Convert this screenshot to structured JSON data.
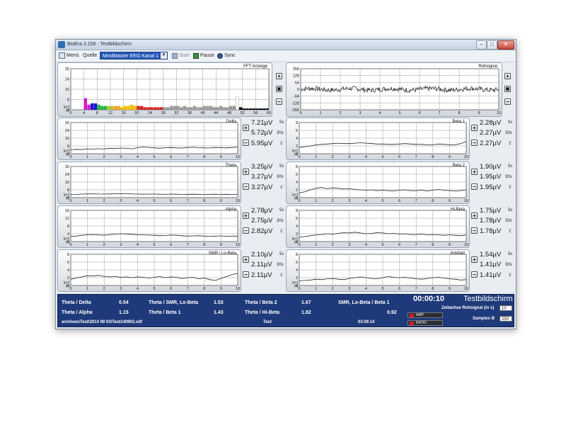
{
  "window": {
    "title": "BioEra 3.156 - Testbildschirm",
    "min": "–",
    "max": "□",
    "close": "✕"
  },
  "toolbar": {
    "menu": "Menü",
    "source_label": "Quelle",
    "source_value": "MindMaster EEG Kanal 1",
    "start": "Start",
    "pause": "Pause",
    "sync": "Sync"
  },
  "fft": {
    "title": "FFT Anzeige",
    "ylim": [
      0,
      32
    ],
    "yticks": [
      "32",
      "24",
      "16",
      "8",
      "0"
    ],
    "xticks": [
      "0",
      "4",
      "8",
      "12",
      "16",
      "20",
      "24",
      "28",
      "32",
      "36",
      "40",
      "44",
      "48",
      "52",
      "56",
      "60"
    ],
    "unit": "[µV]",
    "unit2": "[0]",
    "bars": [
      {
        "x": 4,
        "v": 9,
        "c": "#d319c8"
      },
      {
        "x": 5,
        "v": 4,
        "c": "#d319c8"
      },
      {
        "x": 6,
        "v": 5,
        "c": "#1919d3"
      },
      {
        "x": 7,
        "v": 5,
        "c": "#1919d3"
      },
      {
        "x": 8,
        "v": 4,
        "c": "#23b53c"
      },
      {
        "x": 9,
        "v": 3,
        "c": "#23b53c"
      },
      {
        "x": 10,
        "v": 3,
        "c": "#23b53c"
      },
      {
        "x": 11,
        "v": 3,
        "c": "#b5c23c"
      },
      {
        "x": 12,
        "v": 3,
        "c": "#b5c23c"
      },
      {
        "x": 13,
        "v": 3,
        "c": "#f0a020"
      },
      {
        "x": 14,
        "v": 3,
        "c": "#f0a020"
      },
      {
        "x": 15,
        "v": 2,
        "c": "#f0c000"
      },
      {
        "x": 16,
        "v": 3,
        "c": "#f0c000"
      },
      {
        "x": 17,
        "v": 3,
        "c": "#f0c000"
      },
      {
        "x": 18,
        "v": 4,
        "c": "#f0c000"
      },
      {
        "x": 19,
        "v": 3,
        "c": "#f0c000"
      },
      {
        "x": 20,
        "v": 3,
        "c": "#d52525"
      },
      {
        "x": 21,
        "v": 3,
        "c": "#d52525"
      },
      {
        "x": 22,
        "v": 2,
        "c": "#d52525"
      },
      {
        "x": 23,
        "v": 2,
        "c": "#d52525"
      },
      {
        "x": 24,
        "v": 2,
        "c": "#d52525"
      },
      {
        "x": 25,
        "v": 2,
        "c": "#d52525"
      },
      {
        "x": 26,
        "v": 2,
        "c": "#d52525"
      },
      {
        "x": 27,
        "v": 2,
        "c": "#d52525"
      },
      {
        "x": 28,
        "v": 2,
        "c": "#9a9a9a"
      },
      {
        "x": 29,
        "v": 2,
        "c": "#9a9a9a"
      },
      {
        "x": 30,
        "v": 3,
        "c": "#9a9a9a"
      },
      {
        "x": 31,
        "v": 3,
        "c": "#9a9a9a"
      },
      {
        "x": 32,
        "v": 3,
        "c": "#9a9a9a"
      },
      {
        "x": 33,
        "v": 2,
        "c": "#9a9a9a"
      },
      {
        "x": 34,
        "v": 3,
        "c": "#9a9a9a"
      },
      {
        "x": 35,
        "v": 2,
        "c": "#9a9a9a"
      },
      {
        "x": 36,
        "v": 2,
        "c": "#9a9a9a"
      },
      {
        "x": 37,
        "v": 3,
        "c": "#9a9a9a"
      },
      {
        "x": 38,
        "v": 2,
        "c": "#9a9a9a"
      },
      {
        "x": 39,
        "v": 2,
        "c": "#9a9a9a"
      },
      {
        "x": 40,
        "v": 3,
        "c": "#9a9a9a"
      },
      {
        "x": 41,
        "v": 3,
        "c": "#9a9a9a"
      },
      {
        "x": 42,
        "v": 3,
        "c": "#9a9a9a"
      },
      {
        "x": 43,
        "v": 2,
        "c": "#9a9a9a"
      },
      {
        "x": 44,
        "v": 2,
        "c": "#9a9a9a"
      },
      {
        "x": 45,
        "v": 3,
        "c": "#9a9a9a"
      },
      {
        "x": 46,
        "v": 2,
        "c": "#9a9a9a"
      },
      {
        "x": 47,
        "v": 2,
        "c": "#9a9a9a"
      },
      {
        "x": 48,
        "v": 3,
        "c": "#9a9a9a"
      },
      {
        "x": 49,
        "v": 3,
        "c": "#9a9a9a"
      },
      {
        "x": 50,
        "v": 10,
        "c": "#ffffff"
      },
      {
        "x": 51,
        "v": 2,
        "c": "#000000"
      },
      {
        "x": 52,
        "v": 1,
        "c": "#000000"
      },
      {
        "x": 53,
        "v": 1,
        "c": "#000000"
      },
      {
        "x": 54,
        "v": 1,
        "c": "#000000"
      },
      {
        "x": 55,
        "v": 1,
        "c": "#000000"
      },
      {
        "x": 56,
        "v": 1,
        "c": "#000000"
      },
      {
        "x": 57,
        "v": 1,
        "c": "#000000"
      },
      {
        "x": 58,
        "v": 1,
        "c": "#000000"
      },
      {
        "x": 59,
        "v": 1,
        "c": "#000000"
      }
    ]
  },
  "raw": {
    "title": "Rohsignal",
    "yticks": [
      "256",
      "128",
      "64",
      "0",
      "-64",
      "-128",
      "-256"
    ],
    "xticks": [
      "0",
      "1",
      "2",
      "3",
      "4",
      "5",
      "6",
      "7",
      "8",
      "9",
      "10"
    ]
  },
  "bands": [
    {
      "id": "delta",
      "title": "Delta",
      "yticks": [
        "32",
        "24",
        "16",
        "8",
        "0"
      ],
      "ymax": 32,
      "values": [
        "7.21µV",
        "5.72µV",
        "5.95µV"
      ],
      "points": [
        4,
        4.5,
        4.2,
        5,
        4.7,
        5.2,
        4.8,
        5.6,
        5.3,
        5.8,
        5.5,
        5.0,
        6.2,
        6.9,
        6.5,
        6.0,
        5.7,
        6.1,
        6.4,
        6.0,
        5.8,
        6.3,
        6.6,
        6.2,
        6.0,
        5.9,
        6.4,
        6.2,
        6.0,
        6.4,
        6.8
      ]
    },
    {
      "id": "beta1",
      "title": "Beta 1",
      "yticks": [
        "8",
        "6",
        "4",
        "2",
        "0"
      ],
      "ymax": 8,
      "values": [
        "2.28µV",
        "2.27µV",
        "2.27µV"
      ],
      "points": [
        1.6,
        1.8,
        2.0,
        2.3,
        2.4,
        2.5,
        2.6,
        2.7,
        2.6,
        2.6,
        2.7,
        2.8,
        2.7,
        2.6,
        2.5,
        2.5,
        2.4,
        2.4,
        2.5,
        2.6,
        2.5,
        2.4,
        2.4,
        2.3,
        2.3,
        2.5,
        2.4,
        2.3,
        2.3,
        2.6,
        3.1
      ]
    },
    {
      "id": "theta",
      "title": "Theta",
      "yticks": [
        "32",
        "24",
        "16",
        "8",
        "0"
      ],
      "ymax": 32,
      "values": [
        "3.25µV",
        "3.27µV",
        "3.27µV"
      ],
      "points": [
        3.2,
        3.3,
        3.6,
        3.8,
        3.9,
        3.7,
        3.6,
        3.8,
        3.9,
        4.1,
        4.0,
        3.8,
        3.7,
        3.5,
        3.6,
        3.7,
        3.5,
        3.4,
        3.6,
        3.5,
        3.3,
        3.4,
        3.5,
        3.4,
        3.3,
        3.4,
        3.5,
        3.3,
        3.4,
        3.3,
        3.3
      ]
    },
    {
      "id": "beta2",
      "title": "Beta 2",
      "yticks": [
        "8",
        "6",
        "4",
        "2",
        "0"
      ],
      "ymax": 8,
      "values": [
        "1.90µV",
        "1.95µV",
        "1.95µV"
      ],
      "points": [
        1.2,
        1.5,
        2.0,
        2.4,
        2.6,
        2.3,
        2.5,
        2.4,
        2.2,
        2.3,
        2.1,
        2.0,
        1.9,
        2.0,
        1.8,
        1.9,
        1.8,
        1.7,
        1.9,
        2.0,
        1.8,
        1.8,
        1.9,
        1.7,
        1.9,
        2.1,
        1.9,
        1.8,
        1.7,
        1.8,
        2.0
      ]
    },
    {
      "id": "alpha",
      "title": "Alpha",
      "yticks": [
        "16",
        "12",
        "8",
        "4",
        "0"
      ],
      "ymax": 16,
      "values": [
        "2.78µV",
        "2.75µV",
        "2.82µV"
      ],
      "points": [
        2.6,
        2.8,
        3.2,
        3.5,
        3.6,
        3.4,
        3.2,
        3.6,
        3.8,
        4.0,
        3.9,
        3.7,
        3.5,
        3.4,
        3.3,
        3.2,
        3.0,
        3.1,
        3.3,
        3.2,
        3.0,
        2.8,
        2.9,
        3.0,
        2.8,
        2.7,
        2.8,
        2.9,
        2.7,
        2.8,
        2.8
      ]
    },
    {
      "id": "hibeta",
      "title": "Hi-Beta",
      "yticks": [
        "8",
        "6",
        "4",
        "2",
        "0"
      ],
      "ymax": 8,
      "values": [
        "1.75µV",
        "1.78µV",
        "1.78µV"
      ],
      "points": [
        1.1,
        1.3,
        1.5,
        1.7,
        1.8,
        2.0,
        1.9,
        2.1,
        2.3,
        2.2,
        2.4,
        2.2,
        2.0,
        2.1,
        2.3,
        2.2,
        2.0,
        2.1,
        1.9,
        2.0,
        1.8,
        1.8,
        1.9,
        1.7,
        1.8,
        1.7,
        1.6,
        1.7,
        1.6,
        1.5,
        1.7
      ]
    },
    {
      "id": "smr",
      "title": "SMR / Lo-Beta",
      "yticks": [
        "8",
        "6",
        "4",
        "2",
        "0"
      ],
      "ymax": 8,
      "values": [
        "2.10µV",
        "2.11µV",
        "2.11µV"
      ],
      "points": [
        1.6,
        1.9,
        2.2,
        2.5,
        2.4,
        2.6,
        2.3,
        2.2,
        2.3,
        2.1,
        2.2,
        2.0,
        2.2,
        2.1,
        1.9,
        2.1,
        2.3,
        2.0,
        2.2,
        2.1,
        1.8,
        2.0,
        2.1,
        1.7,
        1.9,
        1.5,
        1.3,
        1.8,
        2.3,
        2.8,
        3.1
      ]
    },
    {
      "id": "artefakt",
      "title": "Artefakt",
      "yticks": [
        "8",
        "6",
        "4",
        "2",
        "0"
      ],
      "ymax": 8,
      "values": [
        "1.54µV",
        "1.41µV",
        "1.41µV"
      ],
      "points": [
        1.2,
        1.3,
        1.4,
        1.6,
        1.5,
        1.7,
        1.8,
        1.6,
        1.5,
        1.8,
        2.0,
        2.2,
        2.0,
        1.8,
        1.7,
        2.0,
        2.3,
        2.1,
        2.0,
        2.1,
        1.9,
        1.7,
        1.6,
        1.8,
        2.0,
        2.1,
        1.9,
        1.7,
        1.6,
        1.4,
        1.5
      ]
    }
  ],
  "band_common": {
    "xticks": [
      "0",
      "1",
      "2",
      "3",
      "4",
      "5",
      "6",
      "7",
      "8",
      "9",
      "10"
    ],
    "labels": [
      "5s",
      "30s",
      "1'"
    ],
    "unit": "[µV]",
    "unit2": "[0]"
  },
  "stats": {
    "r1": [
      {
        "label": "Theta / Delta",
        "value": "0.54"
      },
      {
        "label": "Theta / SMR, Lo-Beta",
        "value": "1.53"
      },
      {
        "label": "Theta / Beta 2",
        "value": "1.67"
      },
      {
        "label": "SMR, Lo-Beta / Beta 1",
        "value": "0.92"
      }
    ],
    "r2": [
      {
        "label": "Theta / Alpha",
        "value": "1.15"
      },
      {
        "label": "Theta / Beta 1",
        "value": "1.43"
      },
      {
        "label": "Theta / Hi-Beta",
        "value": "1.82"
      }
    ],
    "file": "archives\\Test\\2014 09 03\\Test140903.xdf",
    "name": "Test",
    "date": "03.09.14",
    "timer": "00:00:10",
    "screen_title": "Testbildschirm",
    "time_axis_label": "Zeitachse Rohsignal (in s)",
    "time_axis_value": "10",
    "samples_label": "Samples Ø",
    "samples_value": "250",
    "amp": "AMP",
    "ratio": "RATIO"
  },
  "buttons": {
    "plus": "+",
    "minus": "−",
    "restore": "▣"
  }
}
